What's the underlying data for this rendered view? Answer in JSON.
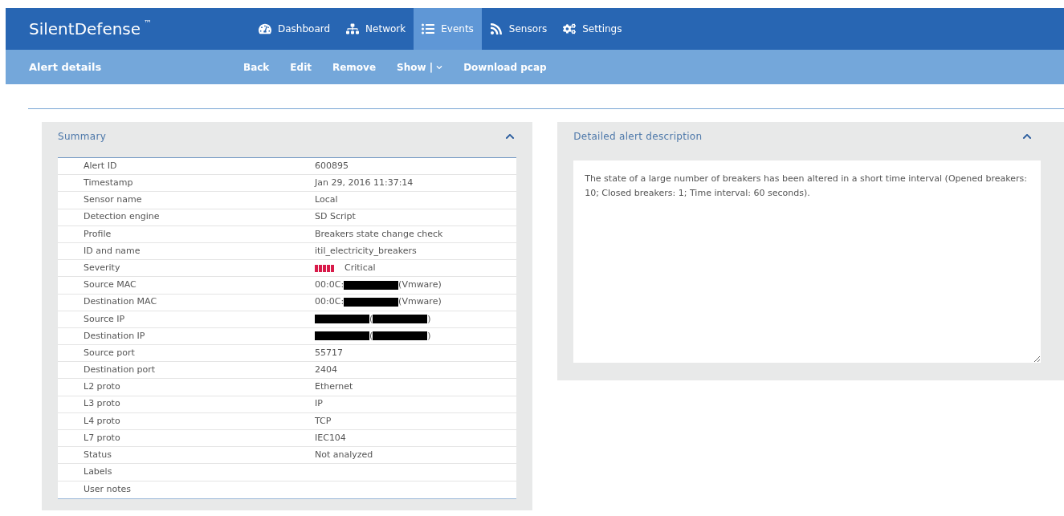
{
  "brand": {
    "name": "SilentDefense",
    "mark": "™"
  },
  "nav": [
    {
      "label": "Dashboard",
      "selected": false
    },
    {
      "label": "Network",
      "selected": false
    },
    {
      "label": "Events",
      "selected": true
    },
    {
      "label": "Sensors",
      "selected": false
    },
    {
      "label": "Settings",
      "selected": false
    }
  ],
  "subbar": {
    "title": "Alert details",
    "actions": [
      {
        "label": "Back",
        "kind": "link"
      },
      {
        "label": "Edit",
        "kind": "link"
      },
      {
        "label": "Remove",
        "kind": "link"
      },
      {
        "label": "Show |",
        "kind": "dropdown"
      },
      {
        "label": "Download pcap",
        "kind": "link"
      }
    ]
  },
  "summary": {
    "title": "Summary",
    "expanded": true,
    "rows": [
      {
        "label": "Alert ID",
        "kind": "text",
        "value": [
          {
            "kind": "text",
            "text": "600895"
          }
        ]
      },
      {
        "label": "Timestamp",
        "kind": "text",
        "value": [
          {
            "kind": "text",
            "text": "Jan 29, 2016 11:37:14"
          }
        ]
      },
      {
        "label": "Sensor name",
        "kind": "text",
        "value": [
          {
            "kind": "text",
            "text": "Local"
          }
        ]
      },
      {
        "label": "Detection engine",
        "kind": "text",
        "value": [
          {
            "kind": "text",
            "text": "SD Script"
          }
        ]
      },
      {
        "label": "Profile",
        "kind": "text",
        "value": [
          {
            "kind": "text",
            "text": "Breakers state change check"
          }
        ]
      },
      {
        "label": "ID and name",
        "kind": "text",
        "value": [
          {
            "kind": "text",
            "text": "itil_electricity_breakers"
          }
        ]
      },
      {
        "label": "Severity",
        "kind": "severity",
        "level": 1,
        "value": [
          {
            "kind": "text",
            "text": "Critical"
          }
        ]
      },
      {
        "label": "Source MAC",
        "kind": "text",
        "value": [
          {
            "kind": "text",
            "text": "00:0C:"
          },
          {
            "kind": "redaction"
          },
          {
            "kind": "text",
            "text": "(Vmware)"
          }
        ]
      },
      {
        "label": "Destination MAC",
        "kind": "text",
        "value": [
          {
            "kind": "text",
            "text": "00:0C:"
          },
          {
            "kind": "redaction"
          },
          {
            "kind": "text",
            "text": "(Vmware)"
          }
        ]
      },
      {
        "label": "Source IP",
        "kind": "text",
        "value": [
          {
            "kind": "redaction"
          },
          {
            "kind": "text",
            "text": "("
          },
          {
            "kind": "redaction"
          },
          {
            "kind": "text",
            "text": ")"
          }
        ]
      },
      {
        "label": "Destination IP",
        "kind": "text",
        "value": [
          {
            "kind": "redaction"
          },
          {
            "kind": "text",
            "text": "("
          },
          {
            "kind": "redaction"
          },
          {
            "kind": "text",
            "text": ")"
          }
        ]
      },
      {
        "label": "Source port",
        "kind": "text",
        "value": [
          {
            "kind": "text",
            "text": "55717"
          }
        ]
      },
      {
        "label": "Destination port",
        "kind": "text",
        "value": [
          {
            "kind": "text",
            "text": "2404"
          }
        ]
      },
      {
        "label": "L2 proto",
        "kind": "text",
        "value": [
          {
            "kind": "text",
            "text": "Ethernet"
          }
        ]
      },
      {
        "label": "L3 proto",
        "kind": "text",
        "value": [
          {
            "kind": "text",
            "text": "IP"
          }
        ]
      },
      {
        "label": "L4 proto",
        "kind": "text",
        "value": [
          {
            "kind": "text",
            "text": "TCP"
          }
        ]
      },
      {
        "label": "L7 proto",
        "kind": "text",
        "value": [
          {
            "kind": "text",
            "text": "IEC104"
          }
        ]
      },
      {
        "label": "Status",
        "kind": "text",
        "value": [
          {
            "kind": "text",
            "text": "Not analyzed"
          }
        ]
      },
      {
        "label": "Labels",
        "kind": "text",
        "value": []
      },
      {
        "label": "User notes",
        "kind": "text",
        "value": []
      }
    ]
  },
  "description": {
    "title": "Detailed alert description",
    "expanded": true,
    "text": "The state of a large number of breakers has been altered in a short time interval (Opened breakers: 10; Closed breakers: 1; Time interval: 60 seconds)."
  }
}
